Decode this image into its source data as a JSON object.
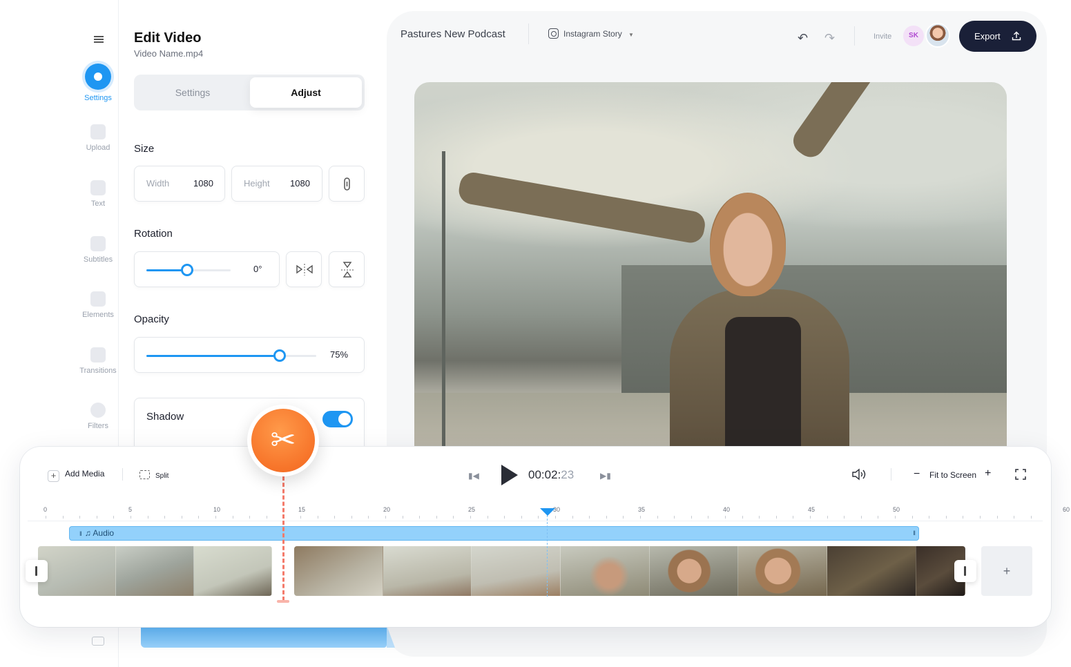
{
  "rail": {
    "items": [
      {
        "label": "Settings",
        "icon": "settings-icon",
        "active": true
      },
      {
        "label": "Upload",
        "icon": "upload-icon"
      },
      {
        "label": "Text",
        "icon": "text-icon"
      },
      {
        "label": "Subtitles",
        "icon": "subtitles-icon"
      },
      {
        "label": "Elements",
        "icon": "elements-icon"
      },
      {
        "label": "Transitions",
        "icon": "transitions-icon"
      },
      {
        "label": "Filters",
        "icon": "filters-icon"
      }
    ]
  },
  "panel": {
    "title": "Edit Video",
    "filename": "Video Name.mp4",
    "tabs": [
      {
        "label": "Settings"
      },
      {
        "label": "Adjust",
        "active": true
      }
    ],
    "size": {
      "heading": "Size",
      "width_label": "Width",
      "width_value": "1080",
      "height_label": "Height",
      "height_value": "1080"
    },
    "rotation": {
      "heading": "Rotation",
      "value": "0°",
      "slider_fraction": 0.5
    },
    "opacity": {
      "heading": "Opacity",
      "value": "75%",
      "slider_fraction": 0.79
    },
    "shadow": {
      "heading": "Shadow",
      "enabled": true
    }
  },
  "topbar": {
    "project": "Pastures New Podcast",
    "format": "Instagram Story",
    "invite": "Invite",
    "user_initials": "SK",
    "export": "Export"
  },
  "timeline": {
    "add_media": "Add Media",
    "split": "Split",
    "time_main": "00:02:",
    "time_frames": "23",
    "fit": "Fit to Screen",
    "ticks": [
      "0",
      "5",
      "10",
      "15",
      "20",
      "25",
      "30",
      "35",
      "40",
      "45",
      "50",
      "60"
    ],
    "audio_label": "Audio",
    "add_clip": "+"
  },
  "colors": {
    "accent": "#1e96f2",
    "export_bg": "#1a2038",
    "cut": "#f3641c"
  }
}
